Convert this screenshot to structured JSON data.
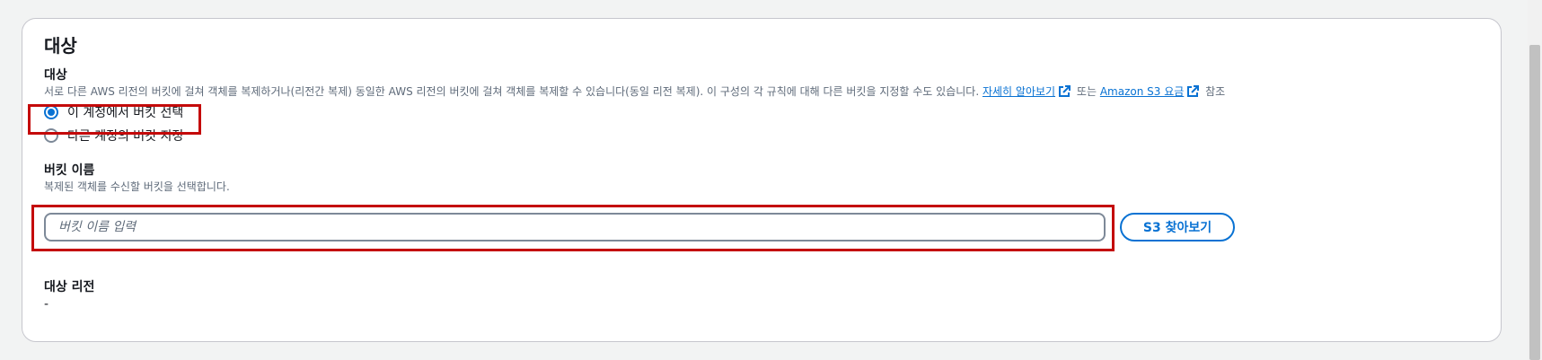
{
  "panel": {
    "title": "대상"
  },
  "destination": {
    "label": "대상",
    "description_text": "서로 다른 AWS 리전의 버킷에 걸쳐 객체를 복제하거나(리전간 복제) 동일한 AWS 리전의 버킷에 걸쳐 객체를 복제할 수 있습니다(동일 리전 복제). 이 구성의 각 규칙에 대해 다른 버킷을 지정할 수도 있습니다.",
    "learn_more_link": "자세히 알아보기",
    "or_text": "또는",
    "pricing_link": "Amazon S3 요금",
    "see_text": "참조",
    "options": [
      {
        "label": "이 계정에서 버킷 선택",
        "selected": true
      },
      {
        "label": "다른 계정의 버킷 지정",
        "selected": false
      }
    ]
  },
  "bucket": {
    "label": "버킷 이름",
    "description": "복제된 객체를 수신할 버킷을 선택합니다.",
    "value": "",
    "placeholder": "버킷 이름 입력",
    "browse_button": "S3 찾아보기"
  },
  "region": {
    "label": "대상 리전",
    "value": "-"
  },
  "colors": {
    "accent": "#0972d3",
    "highlight": "#c40a0a",
    "text": "#16191f",
    "muted": "#5f6b7a"
  },
  "icons": {
    "external_link": "external-link-icon"
  }
}
